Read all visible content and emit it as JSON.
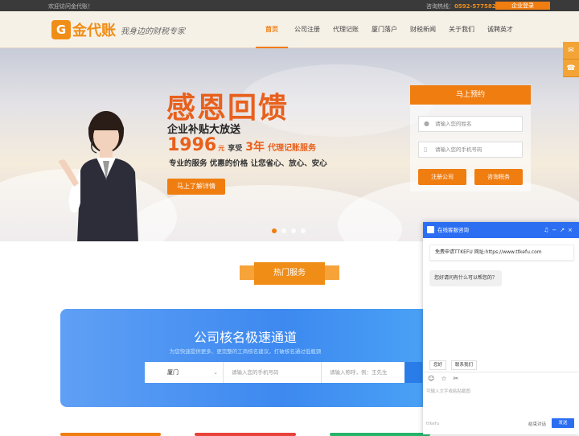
{
  "topbar": {
    "welcome": "欢迎访问金代账！",
    "hotline_label": "咨询热线：",
    "phone": "0592-5775823",
    "login": "企业登录"
  },
  "logo": {
    "mark": "G",
    "name": "金代账",
    "slogan": "我身边的财税专家"
  },
  "nav": {
    "items": [
      "首页",
      "公司注册",
      "代理记账",
      "厦门落户",
      "财税新闻",
      "关于我们",
      "诚聘英才"
    ],
    "active": "首页"
  },
  "banner": {
    "title": "感恩回馈",
    "subtitle": "企业补贴大放送",
    "price": "1996",
    "yuan": "元",
    "enjoy": "享受",
    "years": "3年",
    "service": "代理记账服务",
    "desc": "专业的服务 优惠的价格 让您省心、放心、安心",
    "cta": "马上了解详情",
    "slides": 4,
    "active_slide": 1
  },
  "booking": {
    "title": "马上预约",
    "name_placeholder": "请输入您的姓名",
    "phone_placeholder": "请输入您的手机号码",
    "register_btn": "注册公司",
    "consult_btn": "咨询税务"
  },
  "hot": {
    "label": "热门服务"
  },
  "fast_channel": {
    "title": "公司核名极速通道",
    "subtitle": "为您快速提供更多、更完整的工商核名建议，打破核名通过低瓶颈",
    "city": "厦门",
    "phone_placeholder": "请输入您的手机号码",
    "name_placeholder": "请输入称呼，例：王先生"
  },
  "chat": {
    "title": "在线客服咨询",
    "msg1": "免费申请TTKEFU 网址:https://www.ttkefu.com",
    "msg2": "您好请问有什么可以帮您的？",
    "quick1": "您好",
    "quick2": "联系我们",
    "input_placeholder": "可输入文字或粘贴截图",
    "brand": "ttkefu",
    "end": "结束对话",
    "send": "发送"
  },
  "colors": {
    "accent": "#f07d10",
    "chat_blue": "#2b6ef2",
    "fast_blue": "#3d89f0"
  }
}
